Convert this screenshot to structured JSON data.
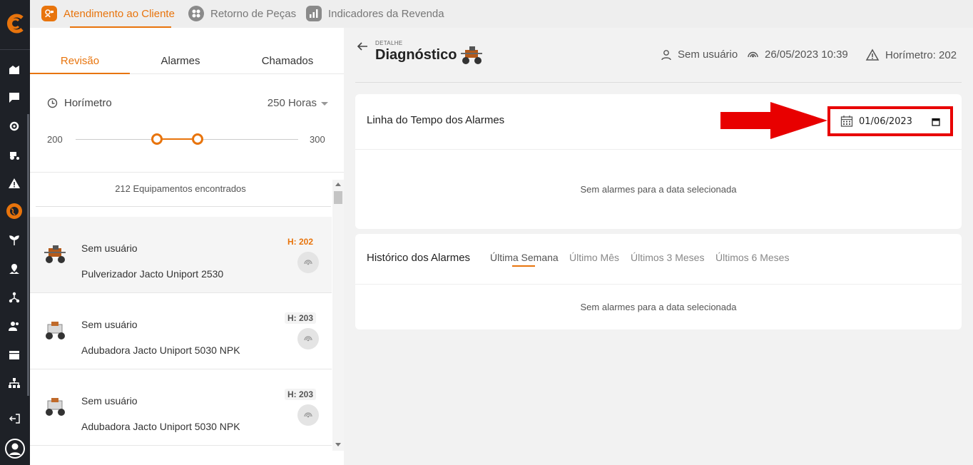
{
  "sidebar": {
    "icons": [
      "farm-icon",
      "chat-icon",
      "gear-network-icon",
      "tractor-icon",
      "warning-icon",
      "globe-icon",
      "plant-icon",
      "map-pin-icon",
      "hierarchy-icon",
      "users-icon",
      "calendar-icon",
      "org-chart-icon"
    ],
    "active": "globe-icon",
    "bottom": [
      "logout-icon",
      "user-profile-icon"
    ]
  },
  "topnav": {
    "tabs": [
      {
        "label": "Atendimento ao Cliente",
        "active": true
      },
      {
        "label": "Retorno de Peças",
        "active": false
      },
      {
        "label": "Indicadores da Revenda",
        "active": false
      }
    ]
  },
  "left_panel": {
    "tabs": [
      "Revisão",
      "Alarmes",
      "Chamados"
    ],
    "active_tab": "Revisão",
    "horimetro_label": "Horímetro",
    "horimetro_value": "250 Horas",
    "slider": {
      "min": "200",
      "max": "300",
      "low": 236,
      "high": 254
    },
    "results_text": "212 Equipamentos encontrados",
    "items": [
      {
        "user": "Sem usuário",
        "model": "Pulverizador Jacto Uniport 2530",
        "hours": "H: 202",
        "selected": true
      },
      {
        "user": "Sem usuário",
        "model": "Adubadora Jacto Uniport 5030 NPK",
        "hours": "H: 203",
        "selected": false
      },
      {
        "user": "Sem usuário",
        "model": "Adubadora Jacto Uniport 5030 NPK",
        "hours": "H: 203",
        "selected": false
      }
    ]
  },
  "detail": {
    "eyebrow": "DETALHE",
    "title": "Diagnóstico",
    "user": "Sem usuário",
    "datetime": "26/05/2023 10:39",
    "horimetro": "Horímetro: 202"
  },
  "timeline_card": {
    "title": "Linha do Tempo dos Alarmes",
    "date_value": "01/06/2023",
    "empty_text": "Sem alarmes para a data selecionada"
  },
  "history_card": {
    "title": "Histórico dos Alarmes",
    "tabs": [
      "Última Semana",
      "Último Mês",
      "Últimos 3 Meses",
      "Últimos 6 Meses"
    ],
    "active_tab": "Última Semana",
    "empty_text": "Sem alarmes para a data selecionada"
  },
  "colors": {
    "accent": "#e8740c",
    "highlight": "#e80000",
    "rail": "#1e2127"
  }
}
